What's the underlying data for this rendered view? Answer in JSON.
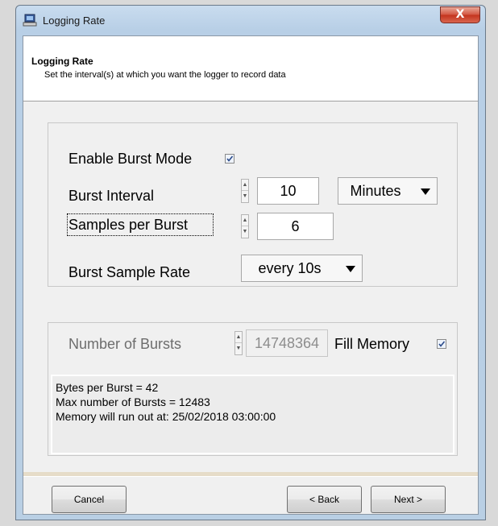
{
  "window": {
    "title": "Logging Rate",
    "close_symbol": "X",
    "icon": "logger-computer-icon"
  },
  "header": {
    "title": "Logging Rate",
    "subtitle": "Set the interval(s) at which you want the logger to record data"
  },
  "burst": {
    "enable_label": "Enable Burst Mode",
    "enable_checked": true,
    "interval_label": "Burst Interval",
    "interval_value": "10",
    "interval_unit": "Minutes",
    "samples_label": "Samples per Burst",
    "samples_value": "6",
    "sample_rate_label": "Burst Sample Rate",
    "sample_rate_value": "every 10s"
  },
  "bursts": {
    "number_label": "Number of Bursts",
    "number_value": "14748364",
    "fill_memory_label": "Fill Memory",
    "fill_memory_checked": true
  },
  "info": {
    "line1": "Bytes per Burst = 42",
    "line2": "Max number of Bursts = 12483",
    "line3": "Memory will run out at: 25/02/2018 03:00:00"
  },
  "buttons": {
    "cancel": "Cancel",
    "back": "< Back",
    "next": "Next >"
  },
  "colors": {
    "close_button": "#c3331d",
    "header_bg": "#ffffff",
    "client_bg": "#f0f0f0",
    "disabled_text": "#6d6d6d"
  }
}
